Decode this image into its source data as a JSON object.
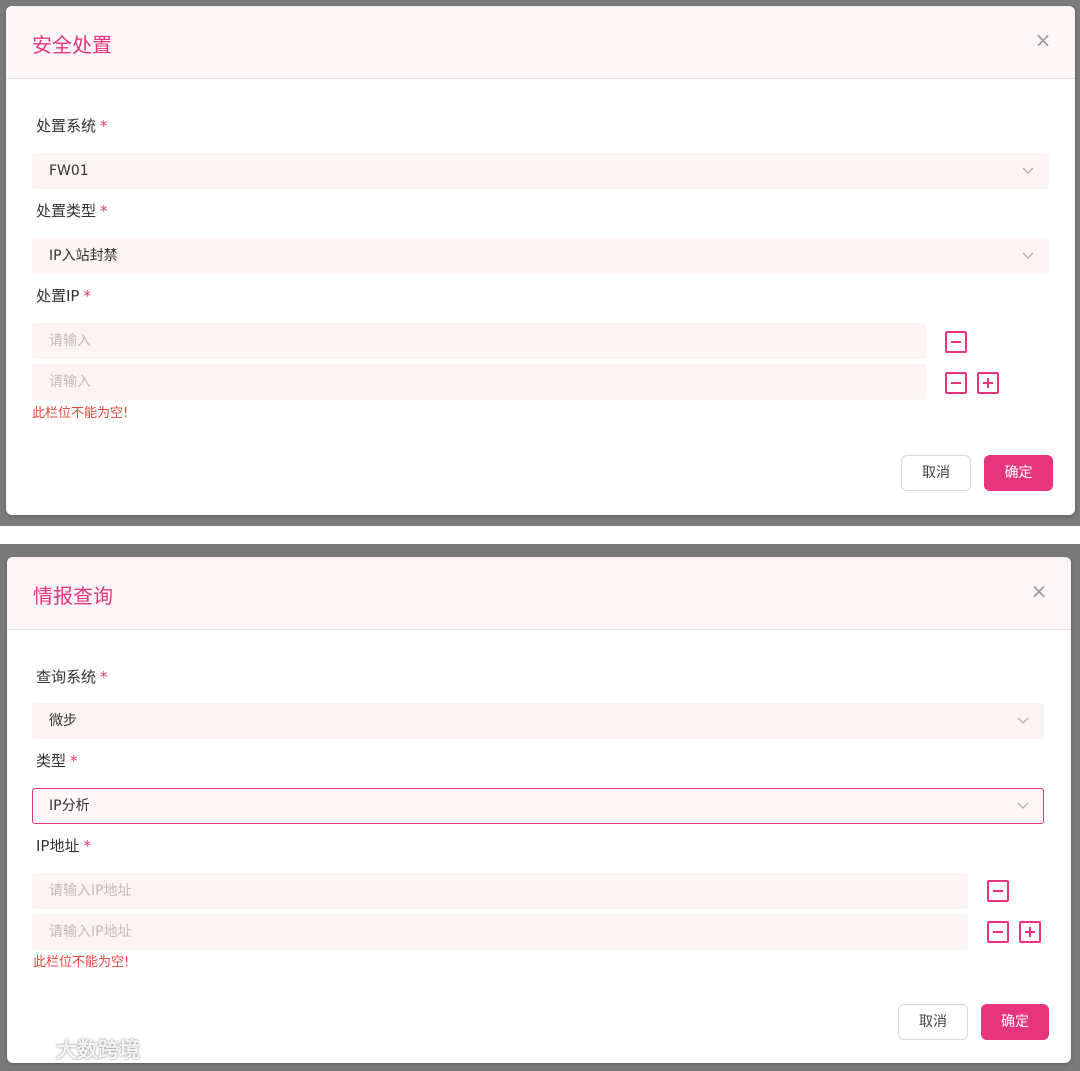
{
  "dialogs": [
    {
      "title": "安全处置",
      "close_symbol": "×",
      "fields": {
        "system": {
          "label": "处置系统",
          "required": "*",
          "value": "FW01"
        },
        "type": {
          "label": "处置类型",
          "required": "*",
          "value": "IP入站封禁"
        },
        "ip": {
          "label": "处置IP",
          "required": "*",
          "placeholder": "请输入",
          "inputs": [
            "",
            ""
          ]
        }
      },
      "error": "此栏位不能为空!",
      "buttons": {
        "cancel": "取消",
        "ok": "确定"
      }
    },
    {
      "title": "情报查询",
      "close_symbol": "×",
      "fields": {
        "system": {
          "label": "查询系统",
          "required": "*",
          "value": "微步"
        },
        "type": {
          "label": "类型",
          "required": "*",
          "value": "IP分析"
        },
        "ip": {
          "label": "IP地址",
          "required": "*",
          "placeholder": "请输入IP地址",
          "inputs": [
            "",
            ""
          ]
        }
      },
      "error": "此栏位不能为空!",
      "buttons": {
        "cancel": "取消",
        "ok": "确定"
      }
    }
  ],
  "watermark": {
    "text": "大数跨境"
  },
  "colors": {
    "accent": "#e6347d",
    "error": "#e8453c",
    "input_bg": "#fcf4f3",
    "header_bg": "#fcf6f6"
  },
  "icons": [
    "close-icon",
    "chevron-down-icon",
    "minus-icon",
    "plus-icon",
    "watermark-logo-icon"
  ]
}
